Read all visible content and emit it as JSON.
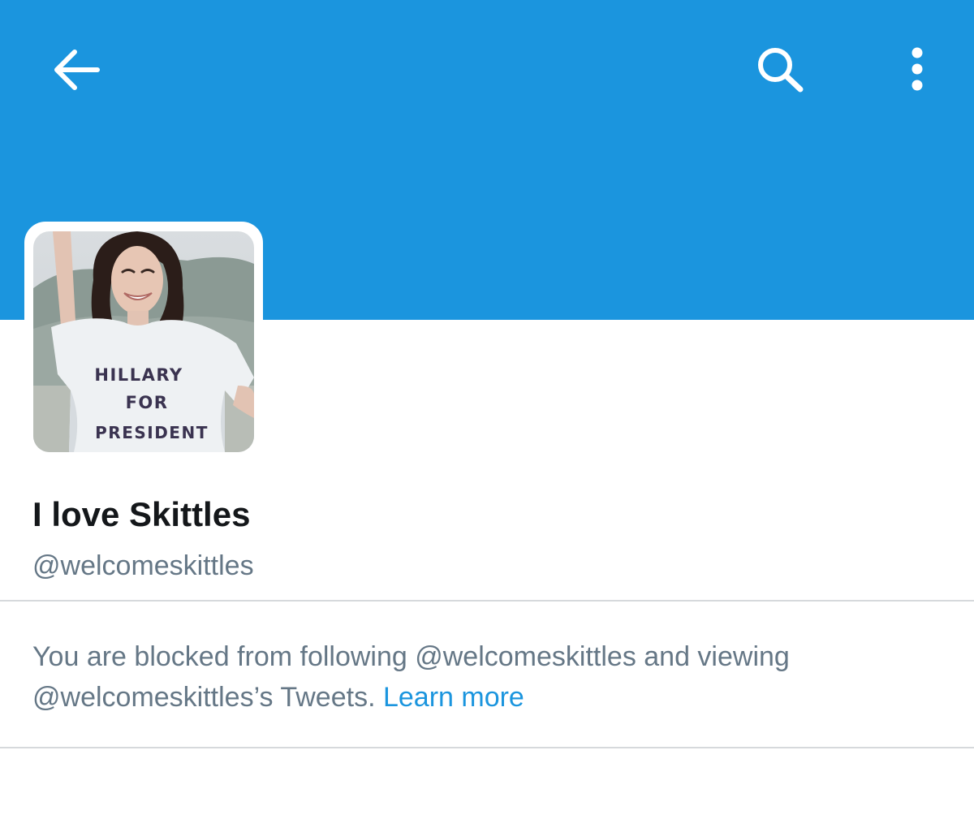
{
  "header": {
    "background_color": "#1b95de",
    "back_icon": "arrow-left-icon",
    "search_icon": "search-icon",
    "more_icon": "more-vertical-icon"
  },
  "profile": {
    "avatar_shirt_text": [
      "HILLARY",
      "FOR",
      "PRESIDENT"
    ],
    "display_name": "I love Skittles",
    "handle": "@welcomeskittles"
  },
  "blocked_notice": {
    "message": "You are blocked from following @welcomeskittles and viewing @welcomeskittles’s Tweets. ",
    "link_text": "Learn more",
    "link_color": "#1b95de"
  }
}
